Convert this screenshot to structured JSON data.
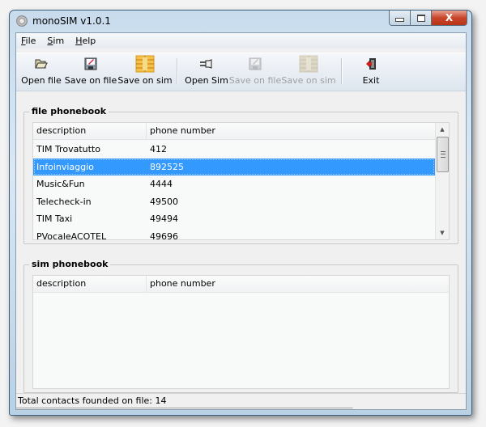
{
  "window": {
    "title": "monoSIM v1.0.1",
    "caption_buttons": {
      "minimize": "–",
      "maximize": "□",
      "close": "X"
    }
  },
  "menu": [
    {
      "label_ul": "F",
      "label_rest": "ile"
    },
    {
      "label_ul": "S",
      "label_rest": "im"
    },
    {
      "label_ul": "H",
      "label_rest": "elp"
    }
  ],
  "toolbar": {
    "open_file": {
      "label": "Open file",
      "icon": "folder-open-icon",
      "enabled": true
    },
    "save_on_file": {
      "label": "Save on file",
      "icon": "floppy-disk-icon",
      "enabled": true
    },
    "save_on_sim": {
      "label": "Save on sim",
      "icon": "sim-chip-icon",
      "enabled": true
    },
    "open_sim": {
      "label": "Open Sim",
      "icon": "plug-icon",
      "enabled": true
    },
    "save_on_file_2": {
      "label": "Save on file",
      "icon": "floppy-disk-icon",
      "enabled": false
    },
    "save_on_sim_2": {
      "label": "Save on sim",
      "icon": "sim-chip-icon",
      "enabled": false
    },
    "exit": {
      "label": "Exit",
      "icon": "exit-door-icon",
      "enabled": true
    }
  },
  "file_phonebook": {
    "title": "file phonebook",
    "columns": [
      "description",
      "phone number"
    ],
    "rows": [
      {
        "description": "TIM Trovatutto",
        "phone": "412"
      },
      {
        "description": "Infoinviaggio",
        "phone": "892525",
        "selected": true
      },
      {
        "description": "Music&Fun",
        "phone": "4444"
      },
      {
        "description": "Telecheck-in",
        "phone": "49500"
      },
      {
        "description": "TIM Taxi",
        "phone": "49494"
      },
      {
        "description": "PVocaleACOTEL",
        "phone": "49696"
      }
    ],
    "scrollbar": {
      "up": "▲",
      "down": "▼"
    }
  },
  "sim_phonebook": {
    "title": "sim phonebook",
    "columns": [
      "description",
      "phone number"
    ],
    "rows": []
  },
  "status": {
    "text": "Total contacts founded on file: 14"
  },
  "colors": {
    "selection": "#3399ff",
    "close_button": "#c9462c"
  }
}
